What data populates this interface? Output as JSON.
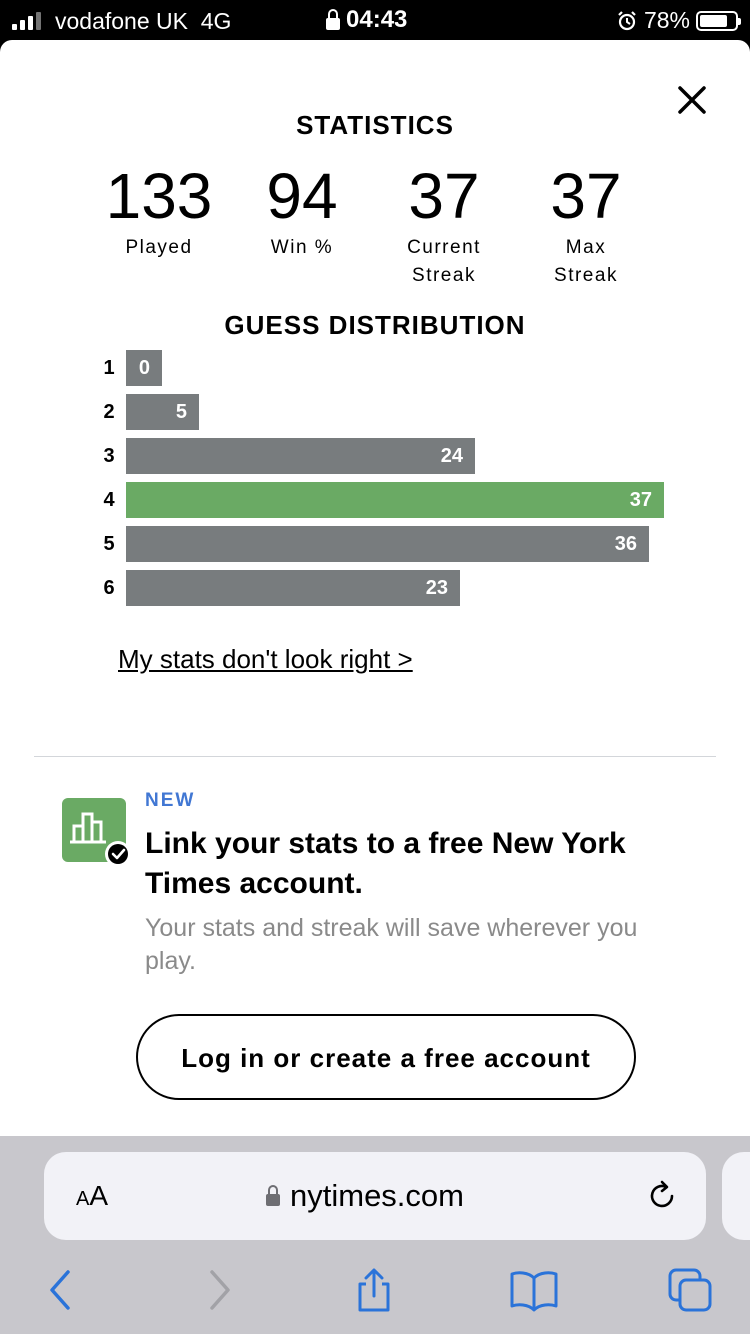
{
  "status_bar": {
    "carrier": "vodafone UK",
    "network": "4G",
    "time": "04:43",
    "battery": "78%",
    "battery_level": 0.78
  },
  "stats": {
    "title": "STATISTICS",
    "played": {
      "value": "133",
      "label": "Played"
    },
    "win_pct": {
      "value": "94",
      "label": "Win %"
    },
    "current_streak": {
      "value": "37",
      "label_line1": "Current",
      "label_line2": "Streak"
    },
    "max_streak": {
      "value": "37",
      "label_line1": "Max",
      "label_line2": "Streak"
    }
  },
  "distribution": {
    "title": "GUESS DISTRIBUTION",
    "rows": [
      {
        "guess": "1",
        "count": 0
      },
      {
        "guess": "2",
        "count": 5
      },
      {
        "guess": "3",
        "count": 24
      },
      {
        "guess": "4",
        "count": 37,
        "highlight": true
      },
      {
        "guess": "5",
        "count": 36
      },
      {
        "guess": "6",
        "count": 23
      }
    ],
    "colors": {
      "bar": "#787c7e",
      "highlight": "#6aaa64"
    }
  },
  "stats_link": "My stats don't look right >",
  "promo": {
    "badge": "NEW",
    "title": "Link your stats to a free New York Times account.",
    "description": "Your stats and streak will save wherever you play.",
    "button_label": "Log in or create a free account",
    "icon": "stats-check-icon"
  },
  "browser": {
    "text_size_label_small": "A",
    "text_size_label_large": "A",
    "url": "nytimes.com"
  }
}
